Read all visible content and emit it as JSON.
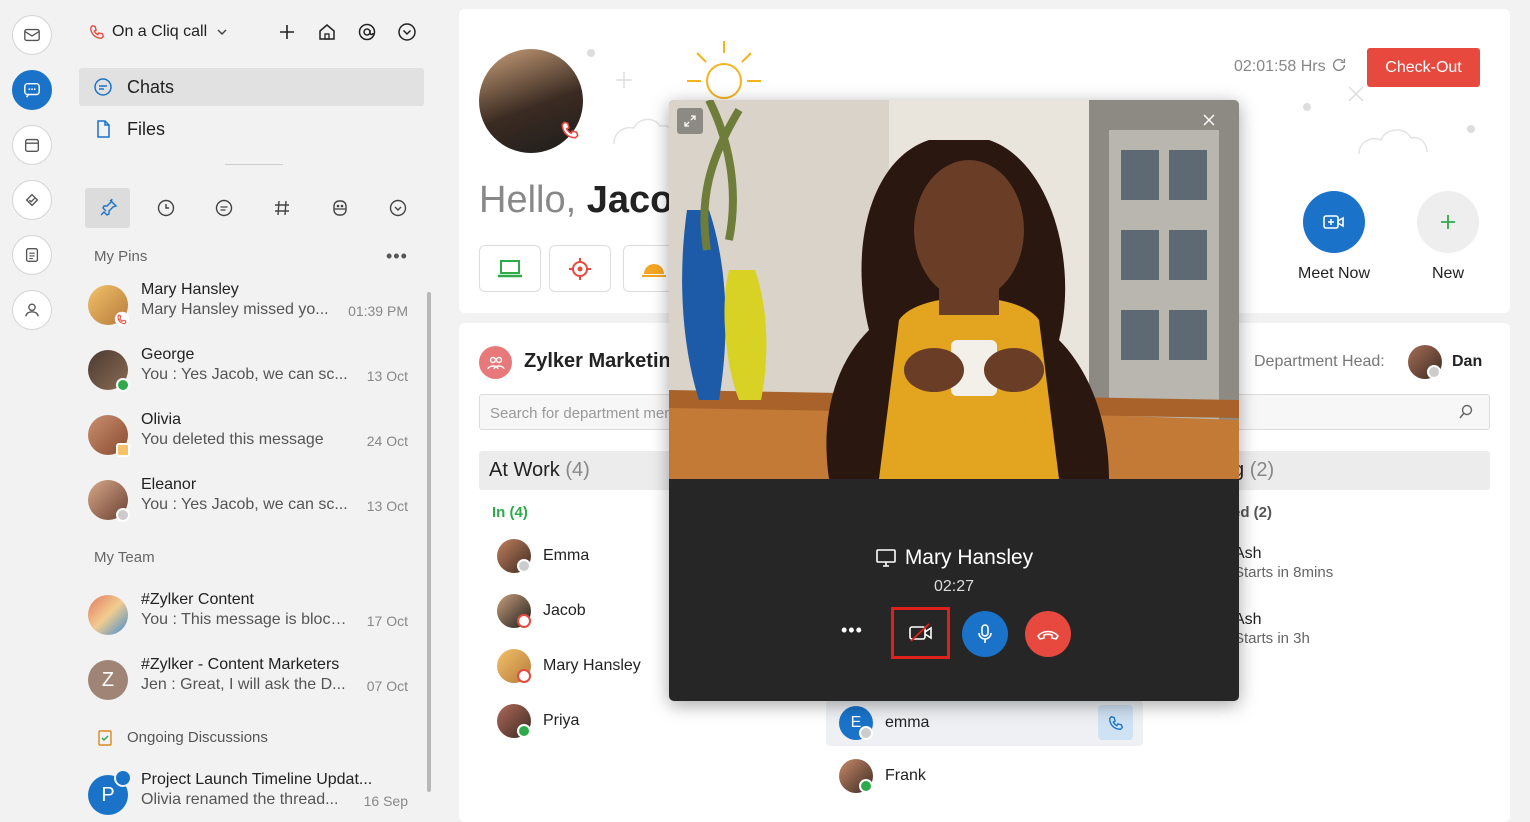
{
  "topbar": {
    "call_status": "On a Cliq call"
  },
  "nav": {
    "chats": "Chats",
    "files": "Files"
  },
  "sections": {
    "pins": "My Pins",
    "team": "My Team",
    "ongoing": "Ongoing Discussions"
  },
  "pins": [
    {
      "name": "Mary Hansley",
      "preview": "Mary  Hansley missed yo...",
      "time": "01:39 PM"
    },
    {
      "name": "George",
      "preview": "You : Yes Jacob, we can sc...",
      "time": "13 Oct"
    },
    {
      "name": "Olivia",
      "preview": "You deleted this message",
      "time": "24 Oct"
    },
    {
      "name": "Eleanor",
      "preview": "You : Yes Jacob, we can sc...",
      "time": "13 Oct"
    }
  ],
  "team": [
    {
      "name": "#Zylker Content",
      "preview": "You : This message is block...",
      "time": "17 Oct",
      "initial": ""
    },
    {
      "name": "#Zylker - Content Marketers",
      "preview": "Jen : Great, I will ask the D...",
      "time": "07 Oct",
      "initial": "Z"
    }
  ],
  "thread": {
    "name": "Project Launch Timeline Updat...",
    "preview": "Olivia renamed the thread...",
    "time": "16 Sep",
    "initial": "P"
  },
  "header": {
    "greeting": "Hello,",
    "user": "Jacob",
    "timer": "02:01:58 Hrs",
    "checkout": "Check-Out",
    "meet_now": "Meet Now",
    "new": "New"
  },
  "department": {
    "name": "Zylker Marketin",
    "head_label": "Department Head:",
    "head_name": "Dan",
    "search_placeholder": "Search for department mem"
  },
  "columns": {
    "at_work": "At Work",
    "at_work_count": "(4)",
    "in_label": "In (4)",
    "right_title": "g",
    "right_count": "(2)",
    "right_sub": "ed (2)"
  },
  "members_in": [
    "Emma",
    "Jacob",
    "Mary  Hansley",
    "Priya"
  ],
  "members_mid": [
    {
      "name": "emma",
      "initial": "E"
    },
    {
      "name": "Frank"
    }
  ],
  "scheduled": [
    {
      "name": "Ash",
      "status": "Starts in 8mins"
    },
    {
      "name": "Ash",
      "status": "Starts in 3h"
    }
  ],
  "call": {
    "name": "Mary  Hansley",
    "duration": "02:27"
  },
  "colors": {
    "accent": "#1a73c9",
    "danger": "#e8493e",
    "green": "#2eaa4a"
  }
}
